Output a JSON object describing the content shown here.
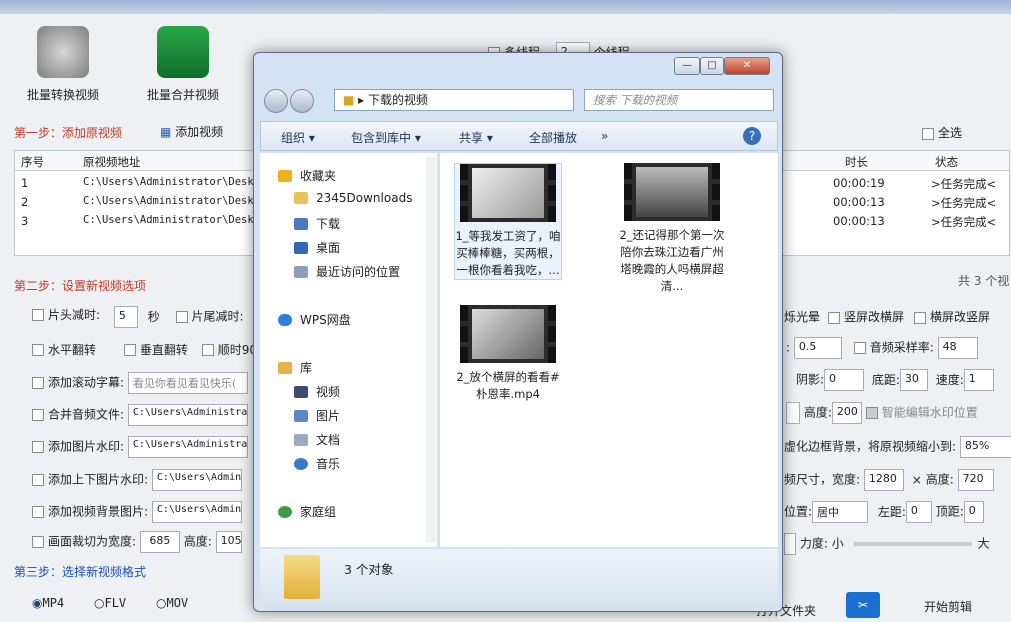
{
  "app": {
    "tools": [
      "批量转换视频",
      "批量合并视频"
    ],
    "step1": "第一步：添加原视频",
    "add_video": "添加视频",
    "select_all": "全选",
    "table": {
      "headers": [
        "序号",
        "原视频地址",
        "时长",
        "状态"
      ],
      "rows": [
        {
          "no": "1",
          "path": "C:\\Users\\Administrator\\Desk",
          "dur": "00:00:19",
          "status": ">任务完成<"
        },
        {
          "no": "2",
          "path": "C:\\Users\\Administrator\\Desk",
          "dur": "00:00:13",
          "status": ">任务完成<"
        },
        {
          "no": "3",
          "path": "C:\\Users\\Administrator\\Desk",
          "dur": "00:00:13",
          "status": ">任务完成<"
        }
      ]
    },
    "step2": "第二步：设置新视频选项",
    "total": "共 3 个视",
    "multithread": "多线程",
    "threads": "2",
    "threads_unit": "个线程",
    "opts": {
      "head_cut": "片头减时:",
      "head_val": "5",
      "sec": "秒",
      "tail_cut": "片尾减时:",
      "hflip": "水平翻转",
      "vflip": "垂直翻转",
      "rot": "顺时90",
      "scroll": "添加滚动字幕:",
      "scroll_text": "看见你看见看见快乐(",
      "merge_audio": "合并音频文件:",
      "path_short": "C:\\Users\\Administra",
      "img_wm": "添加图片水印:",
      "tb_wm": "添加上下图片水印:",
      "path_s2": "C:\\Users\\Admin",
      "bg_img": "添加视频背景图片:",
      "crop": "画面裁切为宽度:",
      "crop_w": "685",
      "height_label": "高度:",
      "crop_h": "105",
      "halo": "烁光晕",
      "v2h": "竖屏改横屏",
      "h2v": "横屏改竖屏",
      "speed_label": ":",
      "speed_val": "0.5",
      "sr": "音频采样率:",
      "sr_val": "48",
      "shadow": "阴影:",
      "shadow_val": "0",
      "bottom": "底距:",
      "bottom_val": "30",
      "speed2": "速度:",
      "speed2_val": "1",
      "height2": "高度:",
      "height2_val": "200",
      "smart_wm": "智能编辑水印位置",
      "blur": "虚化边框背景，将原视频缩小到:",
      "blur_val": "85%",
      "size": "频尺寸，宽度:",
      "w_val": "1280",
      "x": "×",
      "h_label": "高度:",
      "h_val": "720",
      "pos": "位置:",
      "pos_val": "居中",
      "left": "左距:",
      "left_val": "0",
      "top": "顶距:",
      "top_val": "0",
      "strength": "力度:",
      "small": "小",
      "big": "大"
    },
    "step3": "第三步：选择新视频格式",
    "formats": [
      "MP4",
      "FLV",
      "MOV"
    ],
    "open_folder": "打开文件夹",
    "start": "开始剪辑"
  },
  "explorer": {
    "path": "下载的视频",
    "search": "搜索 下载的视频",
    "cmd": [
      "组织 ▾",
      "包含到库中 ▾",
      "共享 ▾",
      "全部播放",
      "»"
    ],
    "nav": [
      {
        "t": "收藏夹",
        "c": "#f2b01e"
      },
      {
        "t": "2345Downloads",
        "c": "#e8c25c"
      },
      {
        "t": "下载",
        "c": "#4b78c4"
      },
      {
        "t": "桌面",
        "c": "#3566b5"
      },
      {
        "t": "最近访问的位置",
        "c": "#8aa0b8"
      },
      {
        "t": "WPS网盘",
        "c": "#2f7de1"
      },
      {
        "t": "库",
        "c": "#e6b34a"
      },
      {
        "t": "视频",
        "c": "#3c4f73"
      },
      {
        "t": "图片",
        "c": "#5b88c7"
      },
      {
        "t": "文档",
        "c": "#9aa9bd"
      },
      {
        "t": "音乐",
        "c": "#3a79c9"
      },
      {
        "t": "家庭组",
        "c": "#3b9a4b"
      }
    ],
    "files": [
      "1_等我发工资了，咱买棒棒糖，买两根，一根你看着我吃，...",
      "2_还记得那个第一次陪你去珠江边看广州塔晚霞的人吗横屏超清...",
      "2_放个横屏的看看#朴恩率.mp4"
    ],
    "status": "3 个对象",
    "win": [
      "—",
      "□",
      "✕"
    ]
  }
}
